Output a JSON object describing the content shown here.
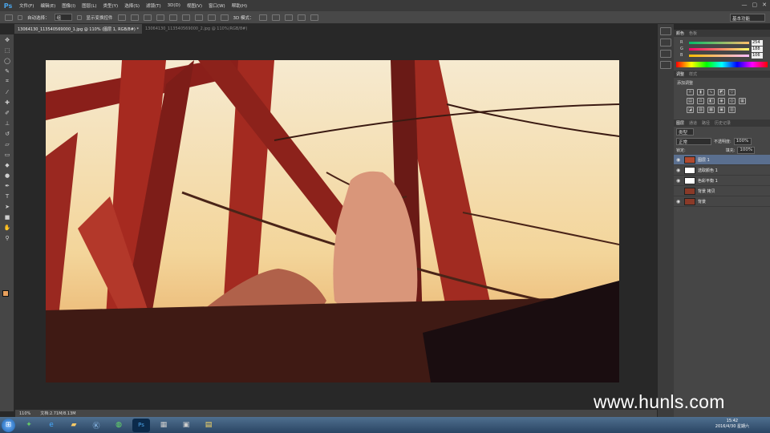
{
  "app": {
    "logo": "Ps"
  },
  "menu": [
    "文件(F)",
    "编辑(E)",
    "图像(I)",
    "图层(L)",
    "类型(Y)",
    "选择(S)",
    "滤镜(T)",
    "3D(D)",
    "视图(V)",
    "窗口(W)",
    "帮助(H)"
  ],
  "window_controls": [
    "—",
    "▢",
    "✕"
  ],
  "options": {
    "auto_select": "自动选择：",
    "auto_select_value": "组",
    "show_transform": "显示变换控件",
    "mode_3d": "3D 模式：",
    "workspace": "基本功能"
  },
  "tabs": [
    {
      "label": "13064130_113540569000_1.jpg @ 110% (图层 1, RGB/8#) *",
      "active": true
    },
    {
      "label": "13064130_113540569000_2.jpg @ 110%(RGB/8#)",
      "active": false
    }
  ],
  "tools": [
    "move",
    "marquee",
    "lasso",
    "quick-select",
    "crop",
    "eyedropper",
    "healing",
    "brush",
    "stamp",
    "history-brush",
    "eraser",
    "gradient",
    "blur",
    "dodge",
    "pen",
    "type",
    "path-select",
    "shape",
    "hand",
    "zoom"
  ],
  "colors": {
    "foreground": "#e9a15d",
    "background": "#ffffff"
  },
  "status": {
    "zoom": "110%",
    "doc": "文档:2.71M/8.13M"
  },
  "color_panel": {
    "tabs": [
      "颜色",
      "色板"
    ],
    "channels": [
      {
        "label": "R",
        "value": "254"
      },
      {
        "label": "G",
        "value": "188"
      },
      {
        "label": "B",
        "value": "106"
      }
    ]
  },
  "adjust_panel": {
    "tabs": [
      "调整",
      "样式"
    ],
    "title": "添加调整"
  },
  "layers_panel": {
    "tabs": [
      "图层",
      "通道",
      "路径",
      "历史记录"
    ],
    "kind": "类型",
    "blend": "正常",
    "opacity_label": "不透明度:",
    "opacity": "100%",
    "lock_label": "锁定:",
    "fill_label": "填充:",
    "fill": "100%",
    "layers": [
      {
        "name": "图层 1",
        "selected": true
      },
      {
        "name": "选取颜色 1",
        "selected": false
      },
      {
        "name": "色彩平衡 1",
        "selected": false
      },
      {
        "name": "背景 拷贝",
        "selected": false
      },
      {
        "name": "背景",
        "selected": false
      }
    ]
  },
  "taskbar": {
    "time": "15:42",
    "date": "2016/4/30 星期六"
  },
  "watermark": "www.hunls.com"
}
